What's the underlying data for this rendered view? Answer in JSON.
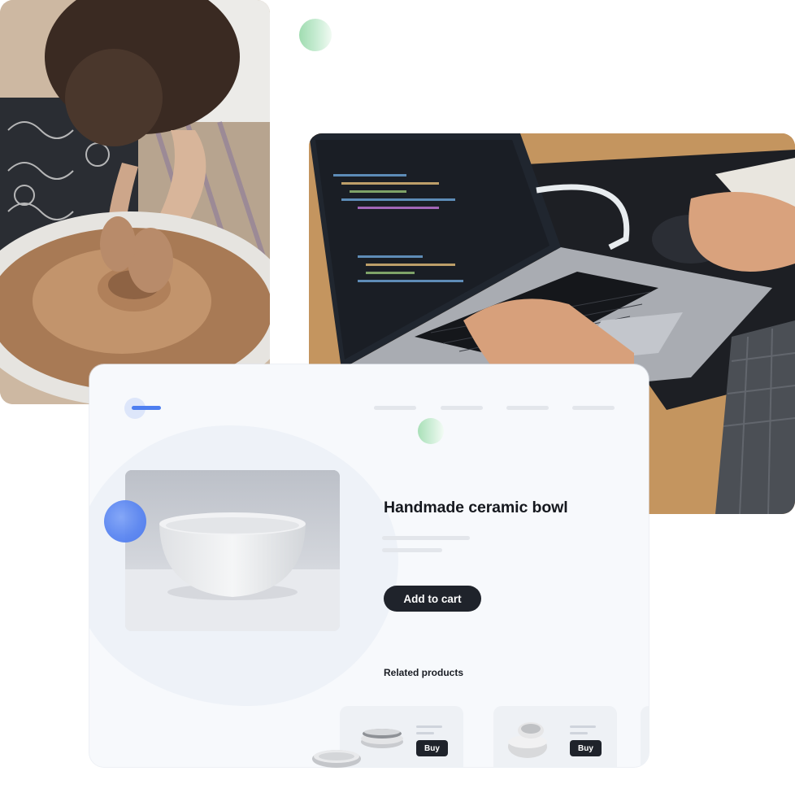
{
  "product": {
    "title": "Handmade ceramic bowl",
    "add_to_cart_label": "Add to cart"
  },
  "related": {
    "heading": "Related products",
    "items": [
      {
        "buy_label": "Buy",
        "image": "stacked-bowls"
      },
      {
        "buy_label": "Buy",
        "image": "speckled-bowls"
      }
    ]
  },
  "images": {
    "hero_left": "pottery-wheel-photo",
    "hero_right": "laptop-coding-photo",
    "product": "white-ceramic-bowl-photo"
  },
  "colors": {
    "accent_blue": "#4e7ff0",
    "accent_green": "#9fdcb0",
    "button_dark": "#1f232b",
    "card_bg": "#f7f9fc"
  }
}
